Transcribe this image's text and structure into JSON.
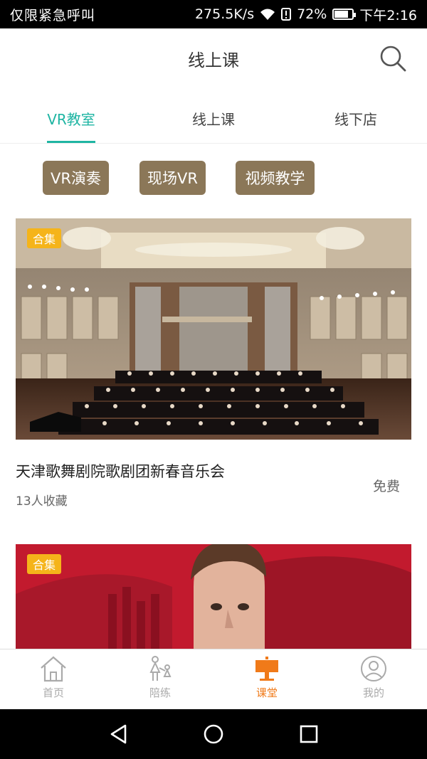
{
  "status_bar": {
    "carrier": "仅限紧急呼叫",
    "speed": "275.5K/s",
    "battery": "72%",
    "battery_level": 0.72,
    "time": "下午2:16"
  },
  "header": {
    "title": "线上课",
    "search_icon": "search-icon"
  },
  "tabs": [
    {
      "label": "VR教室",
      "active": true
    },
    {
      "label": "线上课",
      "active": false
    },
    {
      "label": "线下店",
      "active": false
    }
  ],
  "chips": [
    "VR演奏",
    "现场VR",
    "视频教学"
  ],
  "colors": {
    "accent": "#1fb5a3",
    "chip": "#8b7758",
    "badge": "#f5b41a",
    "nav_active": "#f07a19"
  },
  "cards": [
    {
      "badge": "合集",
      "title": "天津歌舞剧院歌剧团新春音乐会",
      "favorites": "13人收藏",
      "price": "免费"
    },
    {
      "badge": "合集"
    }
  ],
  "bottom_nav": [
    {
      "label": "首页",
      "icon": "home-icon"
    },
    {
      "label": "陪练",
      "icon": "family-icon"
    },
    {
      "label": "课堂",
      "icon": "lectern-icon",
      "active": true
    },
    {
      "label": "我的",
      "icon": "user-icon"
    }
  ],
  "system_nav": {
    "back": "back-icon",
    "home": "home-circle-icon",
    "recents": "recents-icon"
  }
}
